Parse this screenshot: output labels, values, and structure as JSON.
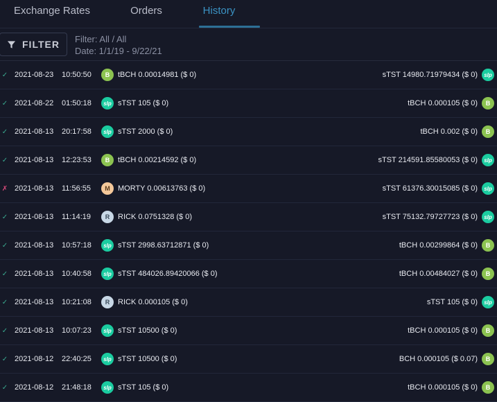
{
  "tabs": [
    {
      "label": "Exchange Rates"
    },
    {
      "label": "Orders"
    },
    {
      "label": "History"
    }
  ],
  "filter": {
    "button_label": "FILTER",
    "filter_text": "Filter: All / All",
    "date_text": "Date: 1/1/19 - 9/22/21"
  },
  "rows": [
    {
      "status": "✓",
      "date": "2021-08-23",
      "time": "10:50:50",
      "left_icon": "bch-icon",
      "left": "tBCH 0.00014981 ($ 0)",
      "right": "sTST 14980.71979434 ($ 0)",
      "right_icon": "slp-icon"
    },
    {
      "status": "✓",
      "date": "2021-08-22",
      "time": "01:50:18",
      "left_icon": "slp-icon",
      "left": "sTST 105 ($ 0)",
      "right": "tBCH 0.000105 ($ 0)",
      "right_icon": "bch-icon"
    },
    {
      "status": "✓",
      "date": "2021-08-13",
      "time": "20:17:58",
      "left_icon": "slp-icon",
      "left": "sTST 2000 ($ 0)",
      "right": "tBCH 0.002 ($ 0)",
      "right_icon": "bch-icon"
    },
    {
      "status": "✓",
      "date": "2021-08-13",
      "time": "12:23:53",
      "left_icon": "bch-icon",
      "left": "tBCH 0.00214592 ($ 0)",
      "right": "sTST 214591.85580053 ($ 0)",
      "right_icon": "slp-icon"
    },
    {
      "status": "✗",
      "date": "2021-08-13",
      "time": "11:56:55",
      "left_icon": "morty-icon",
      "left": "MORTY 0.00613763 ($ 0)",
      "right": "sTST 61376.30015085 ($ 0)",
      "right_icon": "slp-icon"
    },
    {
      "status": "✓",
      "date": "2021-08-13",
      "time": "11:14:19",
      "left_icon": "rick-icon",
      "left": "RICK 0.0751328 ($ 0)",
      "right": "sTST 75132.79727723 ($ 0)",
      "right_icon": "slp-icon"
    },
    {
      "status": "✓",
      "date": "2021-08-13",
      "time": "10:57:18",
      "left_icon": "slp-icon",
      "left": "sTST 2998.63712871 ($ 0)",
      "right": "tBCH 0.00299864 ($ 0)",
      "right_icon": "bch-icon"
    },
    {
      "status": "✓",
      "date": "2021-08-13",
      "time": "10:40:58",
      "left_icon": "slp-icon",
      "left": "sTST 484026.89420066 ($ 0)",
      "right": "tBCH 0.00484027 ($ 0)",
      "right_icon": "bch-icon"
    },
    {
      "status": "✓",
      "date": "2021-08-13",
      "time": "10:21:08",
      "left_icon": "rick-icon",
      "left": "RICK 0.000105 ($ 0)",
      "right": "sTST 105 ($ 0)",
      "right_icon": "slp-icon"
    },
    {
      "status": "✓",
      "date": "2021-08-13",
      "time": "10:07:23",
      "left_icon": "slp-icon",
      "left": "sTST 10500 ($ 0)",
      "right": "tBCH 0.000105 ($ 0)",
      "right_icon": "bch-icon"
    },
    {
      "status": "✓",
      "date": "2021-08-12",
      "time": "22:40:25",
      "left_icon": "slp-icon",
      "left": "sTST 10500 ($ 0)",
      "right": "BCH 0.000105 ($ 0.07)",
      "right_icon": "bch-icon"
    },
    {
      "status": "✓",
      "date": "2021-08-12",
      "time": "21:48:18",
      "left_icon": "slp-icon",
      "left": "sTST 105 ($ 0)",
      "right": "tBCH 0.000105 ($ 0)",
      "right_icon": "bch-icon"
    }
  ],
  "colors": {
    "background": "#161927",
    "active_tab": "#3b93c4",
    "success": "#3aa98f",
    "failure": "#d64a7a",
    "bch": "#8cc351",
    "slp": "#1bcca0"
  }
}
